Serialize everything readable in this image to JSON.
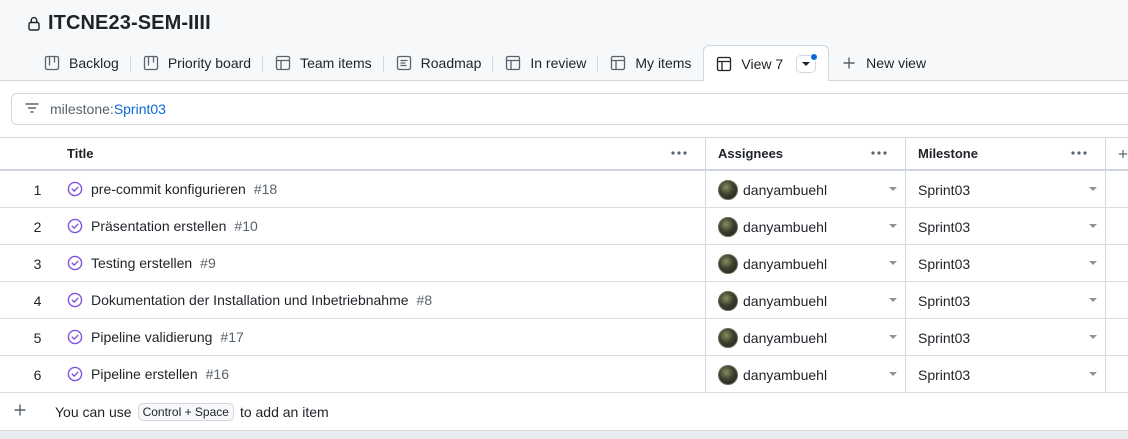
{
  "project": {
    "title": "ITCNE23-SEM-IIII"
  },
  "tabs": [
    {
      "label": "Backlog",
      "icon": "board-icon"
    },
    {
      "label": "Priority board",
      "icon": "board-icon"
    },
    {
      "label": "Team items",
      "icon": "table-icon"
    },
    {
      "label": "Roadmap",
      "icon": "roadmap-icon"
    },
    {
      "label": "In review",
      "icon": "table-icon"
    },
    {
      "label": "My items",
      "icon": "table-icon"
    },
    {
      "label": "View 7",
      "icon": "table-icon",
      "active": true
    }
  ],
  "new_view_label": "New view",
  "filter": {
    "key": "milestone:",
    "value": "Sprint03"
  },
  "columns": {
    "title": "Title",
    "assignees": "Assignees",
    "milestone": "Milestone"
  },
  "rows": [
    {
      "num": "1",
      "title": "pre-commit konfigurieren",
      "issue": "#18",
      "assignee": "danyambuehl",
      "milestone": "Sprint03"
    },
    {
      "num": "2",
      "title": "Präsentation erstellen",
      "issue": "#10",
      "assignee": "danyambuehl",
      "milestone": "Sprint03"
    },
    {
      "num": "3",
      "title": "Testing erstellen",
      "issue": "#9",
      "assignee": "danyambuehl",
      "milestone": "Sprint03"
    },
    {
      "num": "4",
      "title": "Dokumentation der Installation und Inbetriebnahme",
      "issue": "#8",
      "assignee": "danyambuehl",
      "milestone": "Sprint03"
    },
    {
      "num": "5",
      "title": "Pipeline validierung",
      "issue": "#17",
      "assignee": "danyambuehl",
      "milestone": "Sprint03"
    },
    {
      "num": "6",
      "title": "Pipeline erstellen",
      "issue": "#16",
      "assignee": "danyambuehl",
      "milestone": "Sprint03"
    }
  ],
  "add_item": {
    "prefix": "You can use",
    "shortcut": "Control + Space",
    "suffix": "to add an item"
  },
  "colors": {
    "accent": "#0969da",
    "issue_closed": "#8250df",
    "border": "#d0d7de"
  }
}
